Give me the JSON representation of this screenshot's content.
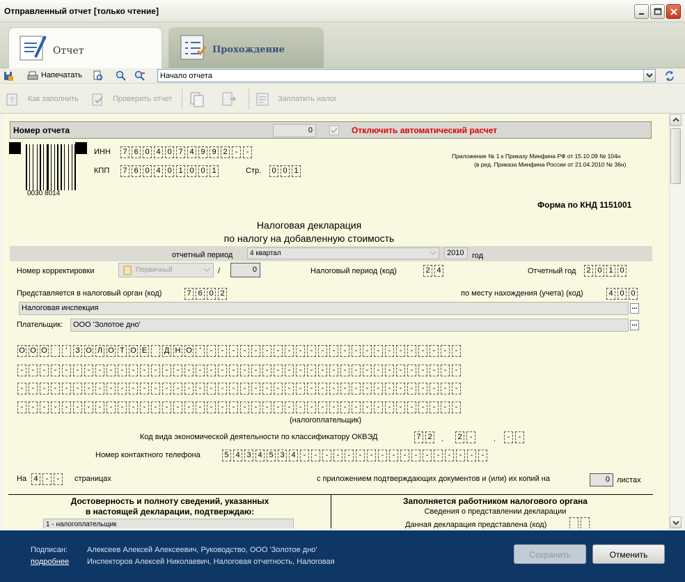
{
  "window": {
    "title": "Отправленный отчет [только чтение]"
  },
  "tabs": [
    {
      "label": "Отчет"
    },
    {
      "label": "Прохождение"
    }
  ],
  "toolbar": {
    "print_label": "Напечатать",
    "nav_value": "Начало отчета"
  },
  "toolbar2": {
    "how_to_fill": "Как заполнить",
    "check_report": "Проверить отчет",
    "pay_tax": "Заплатить налог"
  },
  "report_number": {
    "label": "Номер отчета",
    "value": "0",
    "auto_calc_label": "Отключить автоматический расчет"
  },
  "barcode": {
    "number": "0030 8014"
  },
  "inn": {
    "label": "ИНН",
    "cells": [
      "7",
      "6",
      "0",
      "4",
      "0",
      "7",
      "4",
      "9",
      "9",
      "2",
      "-",
      "-"
    ]
  },
  "kpp": {
    "label": "КПП",
    "cells": [
      "7",
      "6",
      "0",
      "4",
      "0",
      "1",
      "0",
      "0",
      "1"
    ]
  },
  "page": {
    "label": "Стр.",
    "cells": [
      "0",
      "0",
      "1"
    ]
  },
  "appendix": {
    "line1": "Приложение № 1 к Приказу Минфина РФ от 15.10.09 № 104н",
    "line2": "(в ред. Приказа Минфина России от 21.04.2010 № 36н)"
  },
  "form_code": "Форма по КНД 1151001",
  "heading": {
    "line1": "Налоговая декларация",
    "line2": "по налогу на добавленную стоимость"
  },
  "period": {
    "label": "отчетный период",
    "value": "4 квартал",
    "year": "2010",
    "year_label": "год"
  },
  "correction": {
    "label": "Номер корректировки",
    "type": "Первичный",
    "slash": "/",
    "number": "0"
  },
  "tax_period": {
    "label": "Налоговый период (код)",
    "cells": [
      "2",
      "4"
    ]
  },
  "report_year": {
    "label": "Отчетный год",
    "cells": [
      "2",
      "0",
      "1",
      "0"
    ]
  },
  "tax_organ": {
    "label": "Представляется в налоговый орган (код)",
    "cells": [
      "7",
      "6",
      "0",
      "2"
    ],
    "name": "Налоговая инспекция",
    "place_label": "по месту нахождения (учета) (код)",
    "place_cells": [
      "4",
      "0",
      "0"
    ]
  },
  "payer": {
    "label": "Плательщик:",
    "value": "ООО 'Золотое дно'",
    "caption": "(налогоплательщик)"
  },
  "name_rows": [
    [
      "О",
      "О",
      "О",
      " ",
      "'",
      "З",
      "О",
      "Л",
      "О",
      "Т",
      "О",
      "Е",
      " ",
      "Д",
      "Н",
      "О",
      "'",
      "-",
      "-",
      "-",
      "-",
      "-",
      "-",
      "-",
      "-",
      "-",
      "-",
      "-",
      "-",
      "-",
      "-",
      "-",
      "-",
      "-",
      "-",
      "-",
      "-",
      "-",
      "-",
      "-"
    ],
    [
      "-",
      "-",
      "-",
      "-",
      "-",
      "-",
      "-",
      "-",
      "-",
      "-",
      "-",
      "-",
      "-",
      "-",
      "-",
      "-",
      "-",
      "-",
      "-",
      "-",
      "-",
      "-",
      "-",
      "-",
      "-",
      "-",
      "-",
      "-",
      "-",
      "-",
      "-",
      "-",
      "-",
      "-",
      "-",
      "-",
      "-",
      "-",
      "-",
      "-"
    ],
    [
      "-",
      "-",
      "-",
      "-",
      "-",
      "-",
      "-",
      "-",
      "-",
      "-",
      "-",
      "-",
      "-",
      "-",
      "-",
      "-",
      "-",
      "-",
      "-",
      "-",
      "-",
      "-",
      "-",
      "-",
      "-",
      "-",
      "-",
      "-",
      "-",
      "-",
      "-",
      "-",
      "-",
      "-",
      "-",
      "-",
      "-",
      "-",
      "-",
      "-"
    ],
    [
      "-",
      "-",
      "-",
      "-",
      "-",
      "-",
      "-",
      "-",
      "-",
      "-",
      "-",
      "-",
      "-",
      "-",
      "-",
      "-",
      "-",
      "-",
      "-",
      "-",
      "-",
      "-",
      "-",
      "-",
      "-",
      "-",
      "-",
      "-",
      "-",
      "-",
      "-",
      "-",
      "-",
      "-",
      "-",
      "-",
      "-",
      "-",
      "-",
      "-"
    ]
  ],
  "okved": {
    "label": "Код вида экономической деятельности по классификатору ОКВЭД",
    "g1": [
      "7",
      "2"
    ],
    "g2": [
      "2",
      "-"
    ],
    "g3": [
      "-",
      "-"
    ],
    "dot": "."
  },
  "phone": {
    "label": "Номер контактного телефона",
    "cells": [
      "5",
      "4",
      "3",
      "4",
      "5",
      "3",
      "4",
      "-",
      "-",
      "-",
      "-",
      "-",
      "-",
      "-",
      "-",
      "-",
      "-",
      "-",
      "-",
      "-",
      "-",
      "-",
      "-",
      "-"
    ]
  },
  "pages": {
    "prefix": "На",
    "cells": [
      "4",
      "-",
      "-"
    ],
    "suffix": "страницах",
    "docs_label": "с приложением подтверждающих документов и (или) их копий на",
    "docs_value": "0",
    "docs_suffix": "листах"
  },
  "confirm": {
    "line1": "Достоверность и полноту сведений, указанных",
    "line2": "в настоящей декларации, подтверждаю:",
    "select": "1 - налогоплательщик"
  },
  "inspector": {
    "heading": "Заполняется работником налогового органа",
    "sub": "Сведения о представлении декларации",
    "line": "Данная декларация представлена (код)"
  },
  "footer": {
    "signed_label": "Подписан:",
    "more_link": "подробнее",
    "signer1": "Алексеев Алексей Алексеевич, Руководство, ООО 'Золотое дно'",
    "signer2": "Инспекторов Алексей Николаевич, Налоговая отчетность, Налоговая",
    "save": "Сохранить",
    "cancel": "Отменить"
  },
  "colors": {
    "doc_bg": "#f9f9e1",
    "footer_bg": "#0f3766",
    "warning": "#e00000"
  }
}
